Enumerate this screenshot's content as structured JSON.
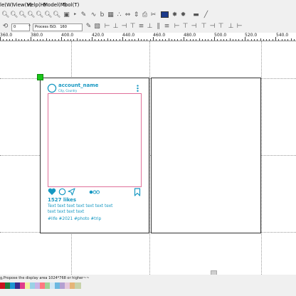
{
  "menubar": [
    "le(W)",
    "View(V)",
    "Help(H)",
    "Model(M)",
    "Tool(T)"
  ],
  "toolbar2": {
    "field1_value": "0",
    "field1_unit": "°",
    "field2_value": "0",
    "field2_label": "Process ISO:",
    "field2_extra": "160"
  },
  "ruler_labels": [
    "360.0",
    "380.0",
    "400.0",
    "420.0",
    "440.0",
    "460.0",
    "480.0",
    "500.0",
    "520.0",
    "540.0"
  ],
  "post": {
    "account_name": "account_name",
    "location": "City, Country",
    "likes": "1527 likes",
    "caption": [
      "Text text text text text text text",
      "text text text text"
    ],
    "hashtags": "#life #2021 #photo #trip"
  },
  "status": {
    "text": "g,Propose the display area 1024*768 or higher~~"
  },
  "colors": {
    "accent": "#1798c2",
    "photo_border": "#e0709a",
    "handle": "#19c519",
    "palette": [
      "#c8141e",
      "#1e7a3c",
      "#1e96d2",
      "#3a2a8c",
      "#e03c8c",
      "#f0f0a0",
      "#9ad2e6",
      "#c8b4e6",
      "#ff7880",
      "#a0d296",
      "#d2e8f5",
      "#6cb8e0",
      "#b4a0d2",
      "#e6c8dc",
      "#e6b478",
      "#c8d2aa"
    ]
  }
}
